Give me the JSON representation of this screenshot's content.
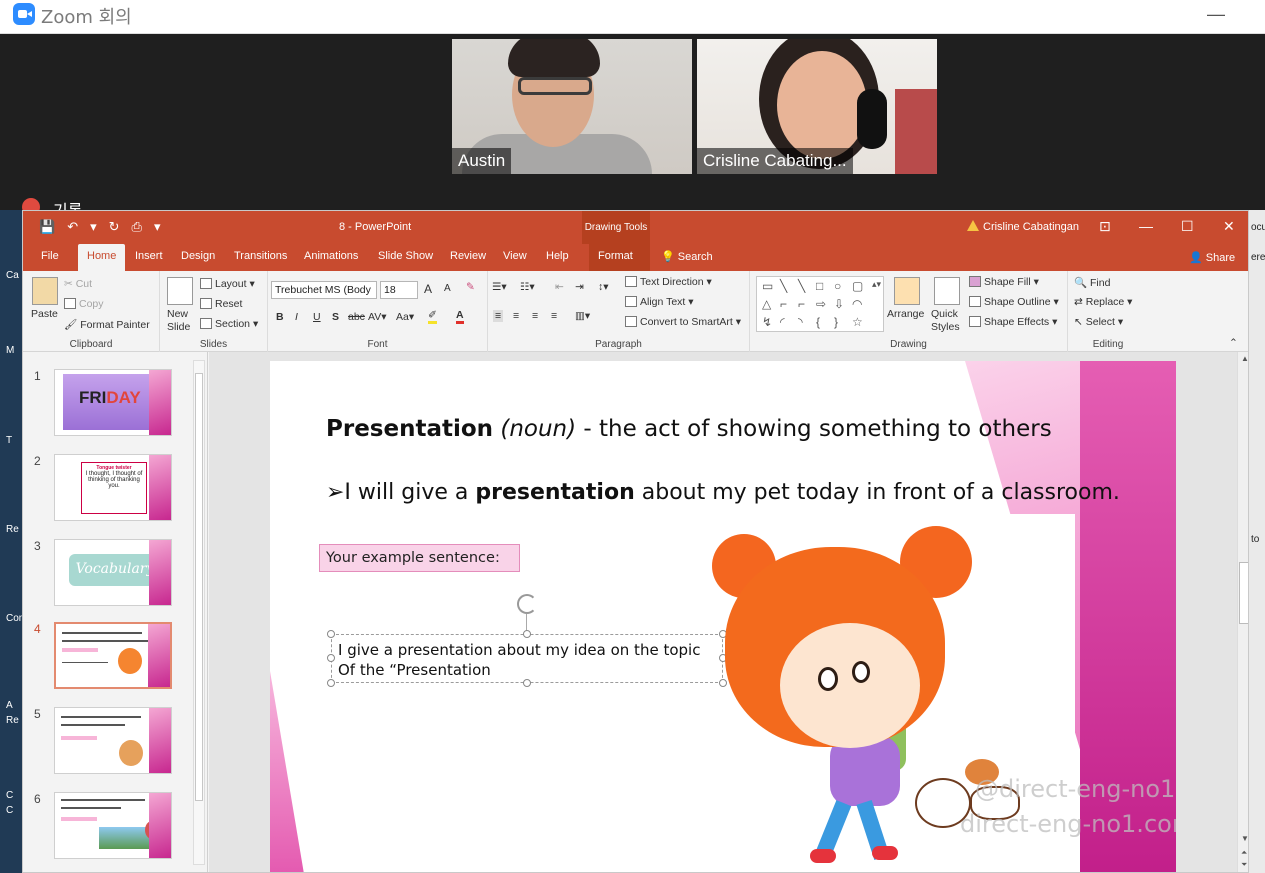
{
  "zoom": {
    "title": "Zoom 회의",
    "minimize": "—",
    "recording_label": "기록",
    "participants": [
      {
        "name": "Austin"
      },
      {
        "name": "Crisline Cabating..."
      }
    ]
  },
  "desktop": {
    "left_labels": [
      "Ca",
      "M",
      "T",
      "Re",
      "Con",
      "A",
      "Re",
      "C",
      "C"
    ],
    "right_labels": [
      "ocu",
      "ere",
      "to"
    ]
  },
  "ppt": {
    "doc_title": "8  -  PowerPoint",
    "drawing_tools": "Drawing Tools",
    "user_name": "Crisline Cabatingan",
    "qat": [
      "💾",
      "↶",
      "▾",
      "↻",
      "⎙",
      "▾"
    ],
    "win_controls": {
      "restore_ribbon": "⊡",
      "minimize": "—",
      "maximize": "☐",
      "close": "✕"
    },
    "tabs": [
      "File",
      "Home",
      "Insert",
      "Design",
      "Transitions",
      "Animations",
      "Slide Show",
      "Review",
      "View",
      "Help"
    ],
    "format_tab": "Format",
    "search": "Search",
    "share": "Share",
    "ribbon": {
      "clipboard": {
        "paste": "Paste",
        "cut": "Cut",
        "copy": "Copy",
        "format_painter": "Format Painter",
        "label": "Clipboard"
      },
      "slides": {
        "new_slide": "New Slide",
        "layout": "Layout",
        "reset": "Reset",
        "section": "Section",
        "label": "Slides"
      },
      "font": {
        "font_name": "Trebuchet MS (Body",
        "font_size": "18",
        "grow": "A",
        "shrink": "A",
        "bold": "B",
        "italic": "I",
        "underline": "U",
        "shadow": "S",
        "strike": "abc",
        "spacing": "AV",
        "case": "Aa",
        "label": "Font"
      },
      "paragraph": {
        "text_direction": "Text Direction",
        "align_text": "Align Text",
        "convert_smartart": "Convert to SmartArt",
        "label": "Paragraph"
      },
      "drawing": {
        "arrange": "Arrange",
        "quick_styles": "Quick Styles",
        "shape_fill": "Shape Fill",
        "shape_outline": "Shape Outline",
        "shape_effects": "Shape Effects",
        "label": "Drawing"
      },
      "editing": {
        "find": "Find",
        "replace": "Replace",
        "select": "Select",
        "label": "Editing"
      }
    },
    "thumbnails": {
      "numbers": [
        "1",
        "2",
        "3",
        "4",
        "5",
        "6"
      ],
      "t1_text_a": "FRI",
      "t1_text_b": "DAY",
      "t2_title": "Tongue twister",
      "t2_text": "I thought, I thought of thinking of thanking you.",
      "t3_text": "Vocabulary"
    },
    "slide": {
      "line1_bold": "Presentation",
      "line1_italic": "(noun)",
      "line1_rest": "  - the act of showing something to others",
      "line2_prefix": "➢I will give a ",
      "line2_bold": "presentation",
      "line2_rest": " about my pet today in front of a classroom.",
      "example_label": "Your example sentence:",
      "textbox_line1": "I give a presentation about my idea on the topic",
      "textbox_line2": "Of the “Presentation",
      "watermark1": "@direct-eng-no1",
      "watermark2": "direct-eng-no1.com"
    }
  }
}
